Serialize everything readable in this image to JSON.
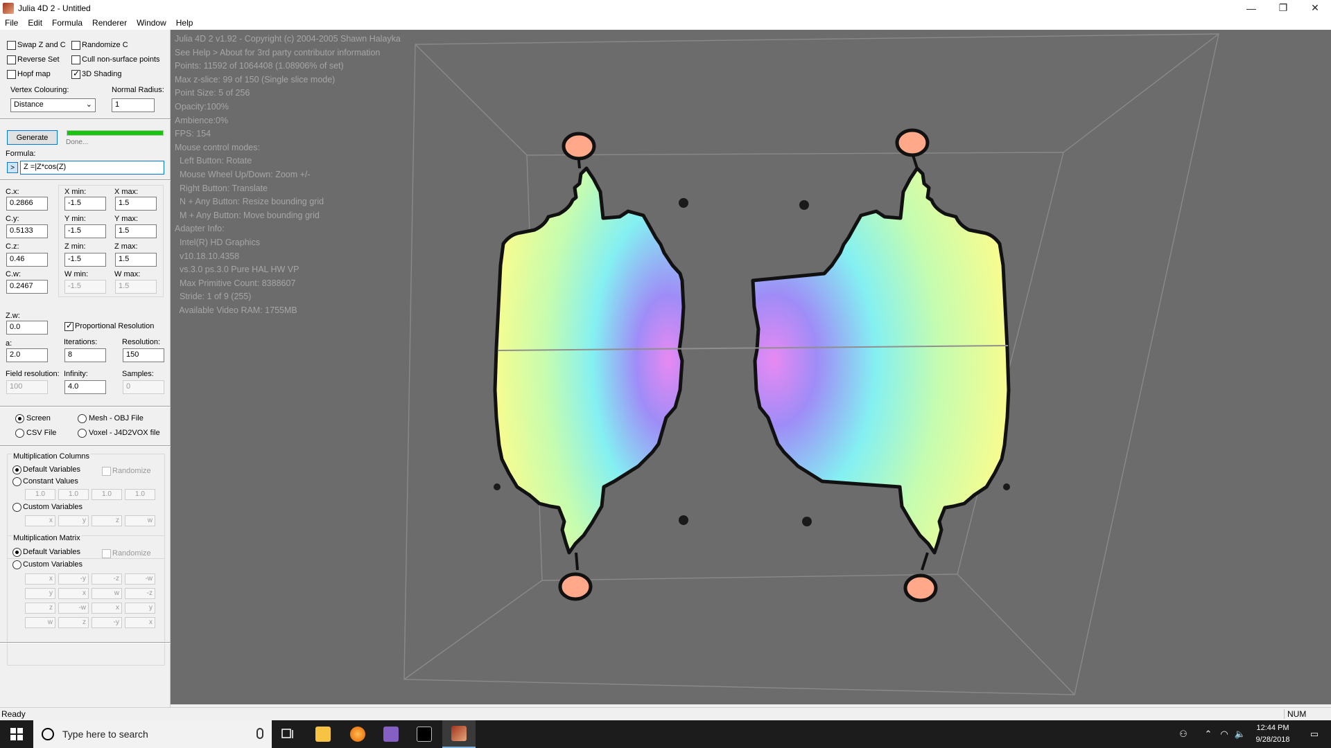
{
  "window": {
    "title": "Julia 4D 2 - Untitled",
    "buttons": [
      "—",
      "❐",
      "✕"
    ]
  },
  "menu": [
    "File",
    "Edit",
    "Formula",
    "Renderer",
    "Window",
    "Help"
  ],
  "options": {
    "swap_z_c": {
      "label": "Swap Z and C",
      "checked": false
    },
    "randomize_c": {
      "label": "Randomize C",
      "checked": false
    },
    "reverse_set": {
      "label": "Reverse Set",
      "checked": false
    },
    "cull_nonsurface": {
      "label": "Cull non-surface points",
      "checked": false
    },
    "hopf_map": {
      "label": "Hopf map",
      "checked": false
    },
    "shading_3d": {
      "label": "3D Shading",
      "checked": true
    }
  },
  "vertex_colouring": {
    "label": "Vertex Colouring:",
    "value": "Distance"
  },
  "normal_radius": {
    "label": "Normal Radius:",
    "value": "1"
  },
  "generate": {
    "label": "Generate",
    "status": "Done...",
    "progress": 1.0
  },
  "formula": {
    "label": "Formula:",
    "toggle": ">",
    "value": "Z =|Z*cos(Z)"
  },
  "params": {
    "cx": {
      "label": "C.x:",
      "value": "0.2866"
    },
    "cy": {
      "label": "C.y:",
      "value": "0.5133"
    },
    "cz": {
      "label": "C.z:",
      "value": "0.46"
    },
    "cw": {
      "label": "C.w:",
      "value": "0.2467"
    },
    "xmin": {
      "label": "X min:",
      "value": "-1.5"
    },
    "xmax": {
      "label": "X max:",
      "value": "1.5"
    },
    "ymin": {
      "label": "Y min:",
      "value": "-1.5"
    },
    "ymax": {
      "label": "Y max:",
      "value": "1.5"
    },
    "zmin": {
      "label": "Z min:",
      "value": "-1.5"
    },
    "zmax": {
      "label": "Z max:",
      "value": "1.5"
    },
    "wmin": {
      "label": "W min:",
      "value": "-1.5"
    },
    "wmax": {
      "label": "W max:",
      "value": "1.5"
    },
    "zw": {
      "label": "Z.w:",
      "value": "0.0"
    },
    "proportional": {
      "label": "Proportional Resolution",
      "checked": true
    },
    "a": {
      "label": "a:",
      "value": "2.0"
    },
    "iterations": {
      "label": "Iterations:",
      "value": "8"
    },
    "resolution": {
      "label": "Resolution:",
      "value": "150"
    },
    "field_resolution": {
      "label": "Field resolution:",
      "value": "100"
    },
    "infinity": {
      "label": "Infinity:",
      "value": "4.0"
    },
    "samples": {
      "label": "Samples:",
      "value": "0"
    }
  },
  "output": {
    "screen": {
      "label": "Screen",
      "checked": true
    },
    "mesh": {
      "label": "Mesh - OBJ File",
      "checked": false
    },
    "csv": {
      "label": "CSV File",
      "checked": false
    },
    "voxel": {
      "label": "Voxel - J4D2VOX file",
      "checked": false
    }
  },
  "mult_columns": {
    "title": "Multiplication Columns",
    "default": "Default Variables",
    "randomize": "Randomize",
    "constant": "Constant Values",
    "constants": [
      "1.0",
      "1.0",
      "1.0",
      "1.0"
    ],
    "custom": "Custom Variables",
    "custom_vars": [
      "x",
      "y",
      "z",
      "w"
    ]
  },
  "mult_matrix": {
    "title": "Multiplication Matrix",
    "default": "Default Variables",
    "randomize": "Randomize",
    "custom": "Custom Variables",
    "rows": [
      [
        "x",
        "-y",
        "-z",
        "-w"
      ],
      [
        "y",
        "x",
        "w",
        "-z"
      ],
      [
        "z",
        "-w",
        "x",
        "y"
      ],
      [
        "w",
        "z",
        "-y",
        "x"
      ]
    ]
  },
  "overlay": [
    "Julia 4D 2 v1.92 - Copyright (c) 2004-2005 Shawn Halayka",
    "See Help > About for 3rd party contributor information",
    "",
    "Points: 11592 of 1064408 (1.08906% of set)",
    "Max z-slice: 99 of 150 (Single slice mode)",
    "Point Size: 5 of 256",
    "Opacity:100%",
    "Ambience:0%",
    "",
    "FPS: 154",
    "",
    "Mouse control modes:",
    "  Left Button: Rotate",
    "  Mouse Wheel Up/Down: Zoom +/-",
    "  Right Button: Translate",
    "  N + Any Button: Resize bounding grid",
    "  M + Any Button: Move bounding grid",
    "",
    "Adapter Info:",
    "  Intel(R) HD Graphics",
    "  v10.18.10.4358",
    "  vs.3.0 ps.3.0 Pure HAL HW VP",
    "  Max Primitive Count: 8388607",
    "  Stride: 1 of 9 (255)",
    "  Available Video RAM: 1755MB"
  ],
  "status": {
    "text": "Ready",
    "num": "NUM"
  },
  "taskbar": {
    "search_placeholder": "Type here to search",
    "time": "12:44 PM",
    "date": "9/28/2018"
  },
  "colors": {
    "viewport_bg": "#6c6c6c",
    "overlay_text": "#a6a6a6",
    "progress": "#16c60c",
    "accent": "#0078d7"
  }
}
